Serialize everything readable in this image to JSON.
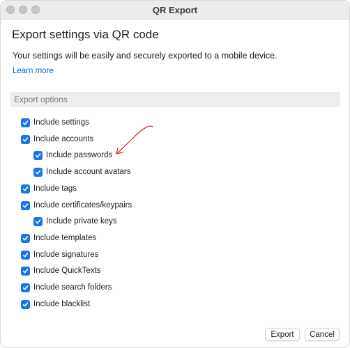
{
  "window": {
    "title": "QR Export"
  },
  "heading": "Export settings via QR code",
  "description": "Your settings will be easily and securely exported to a mobile device.",
  "learn_more": "Learn more",
  "section": {
    "title": "Export options"
  },
  "options": [
    {
      "label": "Include settings",
      "checked": true,
      "indent": 0
    },
    {
      "label": "Include accounts",
      "checked": true,
      "indent": 0
    },
    {
      "label": "Include passwords",
      "checked": true,
      "indent": 1
    },
    {
      "label": "Include account avatars",
      "checked": true,
      "indent": 1
    },
    {
      "label": "Include tags",
      "checked": true,
      "indent": 0
    },
    {
      "label": "Include certificates/keypairs",
      "checked": true,
      "indent": 0
    },
    {
      "label": "Include private keys",
      "checked": true,
      "indent": 1
    },
    {
      "label": "Include templates",
      "checked": true,
      "indent": 0
    },
    {
      "label": "Include signatures",
      "checked": true,
      "indent": 0
    },
    {
      "label": "Include QuickTexts",
      "checked": true,
      "indent": 0
    },
    {
      "label": "Include search folders",
      "checked": true,
      "indent": 0
    },
    {
      "label": "Include blacklist",
      "checked": true,
      "indent": 0
    }
  ],
  "buttons": {
    "export": "Export",
    "cancel": "Cancel"
  },
  "colors": {
    "accent": "#1678e8",
    "link": "#0a63d6",
    "annotation": "#e02020"
  },
  "icons": {
    "checkbox": "checkmark-icon",
    "annotation": "red-arrow-annotation"
  }
}
